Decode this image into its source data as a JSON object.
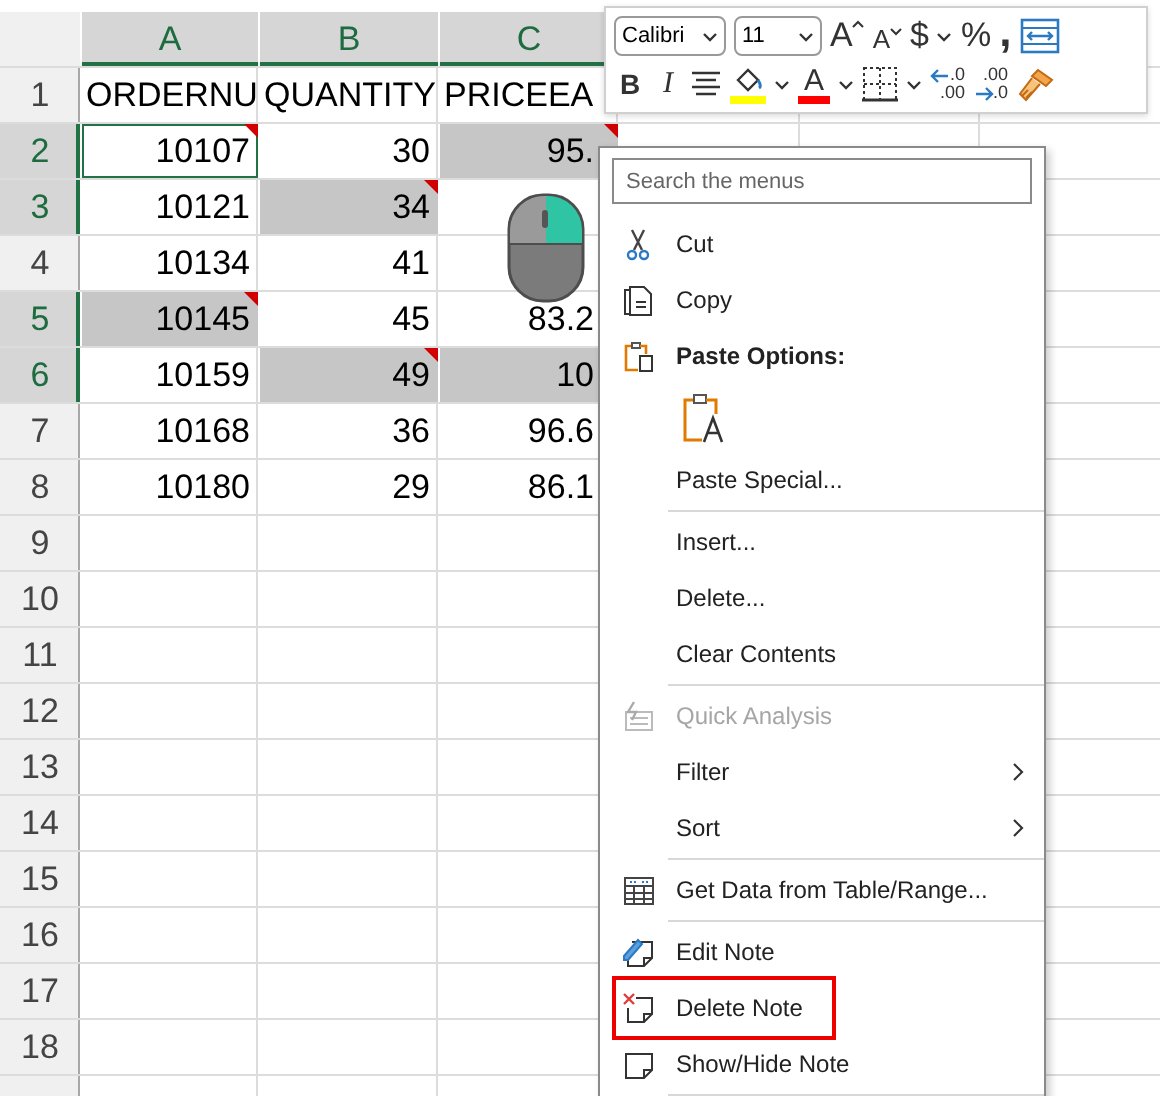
{
  "sheet": {
    "columns": [
      {
        "label": "A",
        "selected": true
      },
      {
        "label": "B",
        "selected": true
      },
      {
        "label": "C",
        "selected": true
      }
    ],
    "rows": [
      {
        "number": "1",
        "selected": false,
        "cells": [
          {
            "kind": "text",
            "text": "ORDERNU",
            "highlighted": false,
            "note": false,
            "active": false
          },
          {
            "kind": "text",
            "text": "QUANTITY",
            "highlighted": false,
            "note": false,
            "active": false
          },
          {
            "kind": "text",
            "text": "PRICEEA",
            "highlighted": false,
            "note": false,
            "active": false
          }
        ]
      },
      {
        "number": "2",
        "selected": true,
        "cells": [
          {
            "kind": "number",
            "text": "10107",
            "highlighted": false,
            "note": true,
            "active": true
          },
          {
            "kind": "number",
            "text": "30",
            "highlighted": false,
            "note": false,
            "active": false
          },
          {
            "kind": "number",
            "text": "95.",
            "highlighted": true,
            "note": true,
            "active": false
          }
        ]
      },
      {
        "number": "3",
        "selected": true,
        "cells": [
          {
            "kind": "number",
            "text": "10121",
            "highlighted": false,
            "note": false,
            "active": false
          },
          {
            "kind": "number",
            "text": "34",
            "highlighted": true,
            "note": true,
            "active": false
          }
        ]
      },
      {
        "number": "4",
        "selected": false,
        "cells": [
          {
            "kind": "number",
            "text": "10134",
            "highlighted": false,
            "note": false,
            "active": false
          },
          {
            "kind": "number",
            "text": "41",
            "highlighted": false,
            "note": false,
            "active": false
          }
        ]
      },
      {
        "number": "5",
        "selected": true,
        "cells": [
          {
            "kind": "number",
            "text": "10145",
            "highlighted": true,
            "note": true,
            "active": false
          },
          {
            "kind": "number",
            "text": "45",
            "highlighted": false,
            "note": false,
            "active": false
          },
          {
            "kind": "number",
            "text": "83.2",
            "highlighted": false,
            "note": false,
            "active": false
          }
        ]
      },
      {
        "number": "6",
        "selected": true,
        "cells": [
          {
            "kind": "number",
            "text": "10159",
            "highlighted": false,
            "note": false,
            "active": false
          },
          {
            "kind": "number",
            "text": "49",
            "highlighted": true,
            "note": true,
            "active": false
          },
          {
            "kind": "number",
            "text": "10",
            "highlighted": true,
            "note": false,
            "active": false
          }
        ]
      },
      {
        "number": "7",
        "selected": false,
        "cells": [
          {
            "kind": "number",
            "text": "10168",
            "highlighted": false,
            "note": false,
            "active": false
          },
          {
            "kind": "number",
            "text": "36",
            "highlighted": false,
            "note": false,
            "active": false
          },
          {
            "kind": "number",
            "text": "96.6",
            "highlighted": false,
            "note": false,
            "active": false
          }
        ]
      },
      {
        "number": "8",
        "selected": false,
        "cells": [
          {
            "kind": "number",
            "text": "10180",
            "highlighted": false,
            "note": false,
            "active": false
          },
          {
            "kind": "number",
            "text": "29",
            "highlighted": false,
            "note": false,
            "active": false
          },
          {
            "kind": "number",
            "text": "86.1",
            "highlighted": false,
            "note": false,
            "active": false
          }
        ]
      },
      {
        "number": "9",
        "selected": false
      },
      {
        "number": "10",
        "selected": false
      },
      {
        "number": "11",
        "selected": false
      },
      {
        "number": "12",
        "selected": false
      },
      {
        "number": "13",
        "selected": false
      },
      {
        "number": "14",
        "selected": false
      },
      {
        "number": "15",
        "selected": false
      },
      {
        "number": "16",
        "selected": false
      },
      {
        "number": "17",
        "selected": false
      },
      {
        "number": "18",
        "selected": false
      }
    ]
  },
  "mini_toolbar": {
    "top_row": [
      {
        "kind": "font-box",
        "label": "Calibri"
      },
      {
        "kind": "size-box",
        "label": "11"
      },
      {
        "kind": "grow",
        "label": "A"
      },
      {
        "kind": "shrink",
        "label": "A"
      },
      {
        "kind": "currency",
        "label": "$"
      },
      {
        "kind": "caret"
      },
      {
        "kind": "percent",
        "label": "%"
      },
      {
        "kind": "comma",
        "label": ","
      },
      {
        "kind": "wrap"
      }
    ],
    "bottom_row": [
      {
        "kind": "bold",
        "label": "B"
      },
      {
        "kind": "italic",
        "label": "I"
      },
      {
        "kind": "align"
      },
      {
        "kind": "fill",
        "color": "#ffff00"
      },
      {
        "kind": "caret"
      },
      {
        "kind": "font-color",
        "label": "A",
        "color": "#ff0000"
      },
      {
        "kind": "caret"
      },
      {
        "kind": "borders"
      },
      {
        "kind": "caret"
      },
      {
        "kind": "decimal-more",
        "top": ".0",
        "bottom": ".00"
      },
      {
        "kind": "decimal-less",
        "top": ".00",
        "bottom": ".0"
      },
      {
        "kind": "painter"
      }
    ]
  },
  "context_menu": {
    "search": {
      "placeholder": "Search the menus"
    },
    "items": [
      {
        "kind": "command",
        "label": "Cut",
        "disabled": false,
        "submenu": false,
        "boxed": false
      },
      {
        "kind": "command",
        "label": "Copy",
        "disabled": false,
        "submenu": false,
        "boxed": false
      },
      {
        "kind": "heading",
        "label": "Paste Options:"
      },
      {
        "kind": "paste-option"
      },
      {
        "kind": "command",
        "label": "Paste Special...",
        "disabled": false,
        "submenu": false,
        "boxed": false
      },
      {
        "kind": "separator"
      },
      {
        "kind": "command",
        "label": "Insert...",
        "disabled": false,
        "submenu": false,
        "boxed": false
      },
      {
        "kind": "command",
        "label": "Delete...",
        "disabled": false,
        "submenu": false,
        "boxed": false
      },
      {
        "kind": "command",
        "label": "Clear Contents",
        "disabled": false,
        "submenu": false,
        "boxed": false
      },
      {
        "kind": "separator"
      },
      {
        "kind": "command",
        "label": "Quick Analysis",
        "disabled": true,
        "submenu": false,
        "boxed": false
      },
      {
        "kind": "command",
        "label": "Filter",
        "disabled": false,
        "submenu": true,
        "boxed": false
      },
      {
        "kind": "command",
        "label": "Sort",
        "disabled": false,
        "submenu": true,
        "boxed": false
      },
      {
        "kind": "separator"
      },
      {
        "kind": "command",
        "label": "Get Data from Table/Range...",
        "disabled": false,
        "submenu": false,
        "boxed": false
      },
      {
        "kind": "separator"
      },
      {
        "kind": "command",
        "label": "Edit Note",
        "disabled": false,
        "submenu": false,
        "boxed": false
      },
      {
        "kind": "command",
        "label": "Delete Note",
        "disabled": false,
        "submenu": false,
        "boxed": true
      },
      {
        "kind": "command",
        "label": "Show/Hide Note",
        "disabled": false,
        "submenu": false,
        "boxed": false
      },
      {
        "kind": "separator"
      }
    ]
  }
}
